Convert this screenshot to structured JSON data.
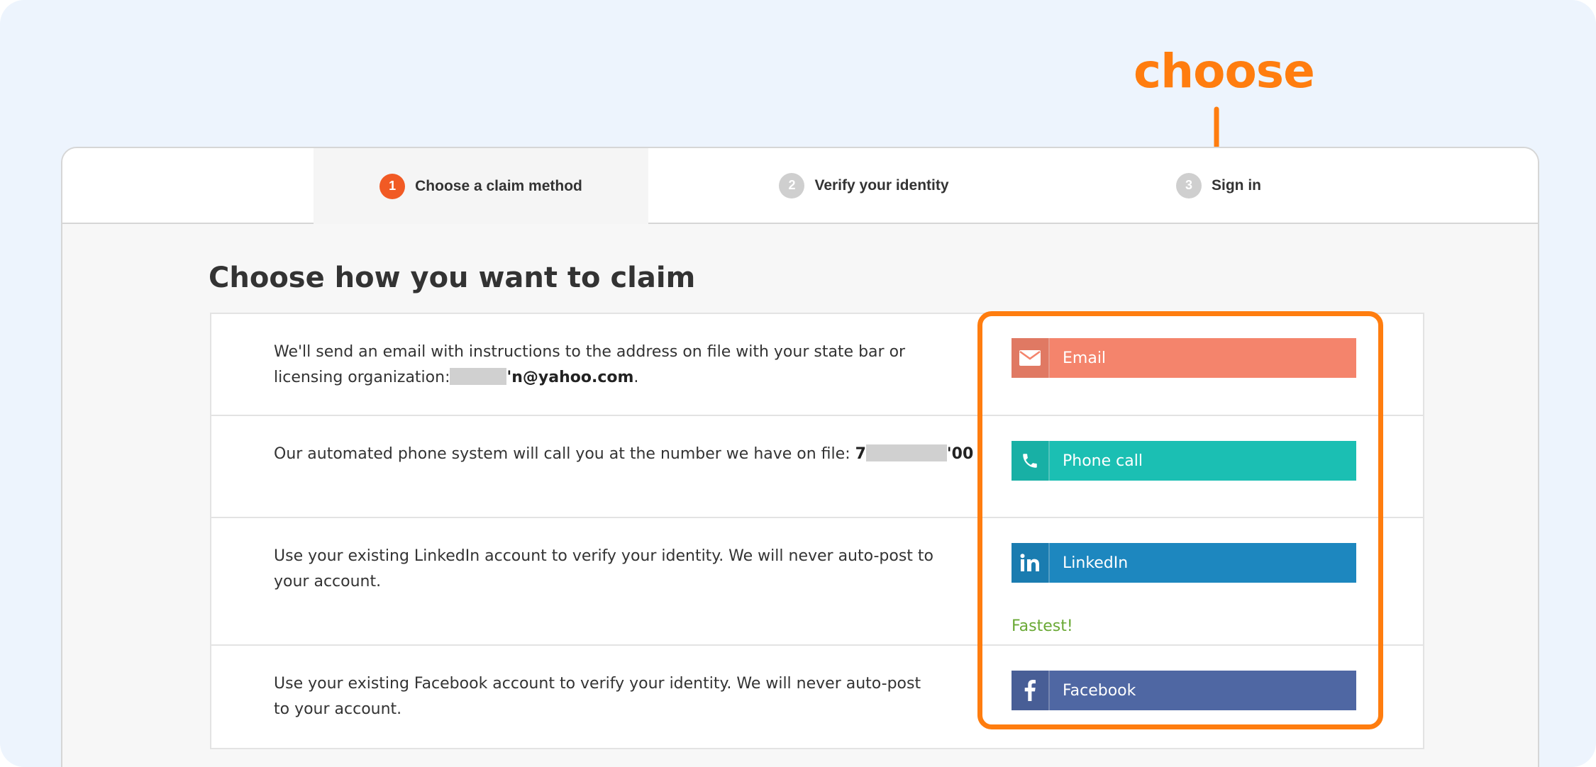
{
  "annotation": {
    "label": "choose",
    "color": "#ff7d0f"
  },
  "stepper": [
    {
      "num": "1",
      "label": "Choose a claim method",
      "active": true
    },
    {
      "num": "2",
      "label": "Verify your identity",
      "active": false
    },
    {
      "num": "3",
      "label": "Sign in",
      "active": false
    }
  ],
  "heading": "Choose how you want to claim",
  "methods": {
    "email": {
      "desc_1": "We'll send an email with instructions to the address on file with your state bar or licensing organization:",
      "email_visible": "'n@yahoo.com",
      "desc_end": ".",
      "button": "Email",
      "icon": "envelope-icon",
      "color": "#f4846c"
    },
    "phone": {
      "desc": "Our automated phone system will call you at the number we have on file: ",
      "phone_start": "7",
      "phone_end": "'00",
      "button": "Phone call",
      "icon": "phone-icon",
      "color": "#1bbfb3"
    },
    "linkedin": {
      "desc": "Use your existing LinkedIn account to verify your identity. We will never auto-post to your account.",
      "button": "LinkedIn",
      "icon": "linkedin-icon",
      "badge": "Fastest!",
      "color": "#1d87bf"
    },
    "facebook": {
      "desc": "Use your existing Facebook account to verify your identity. We will never auto-post to your account.",
      "button": "Facebook",
      "icon": "facebook-icon",
      "color": "#4f67a3"
    }
  }
}
